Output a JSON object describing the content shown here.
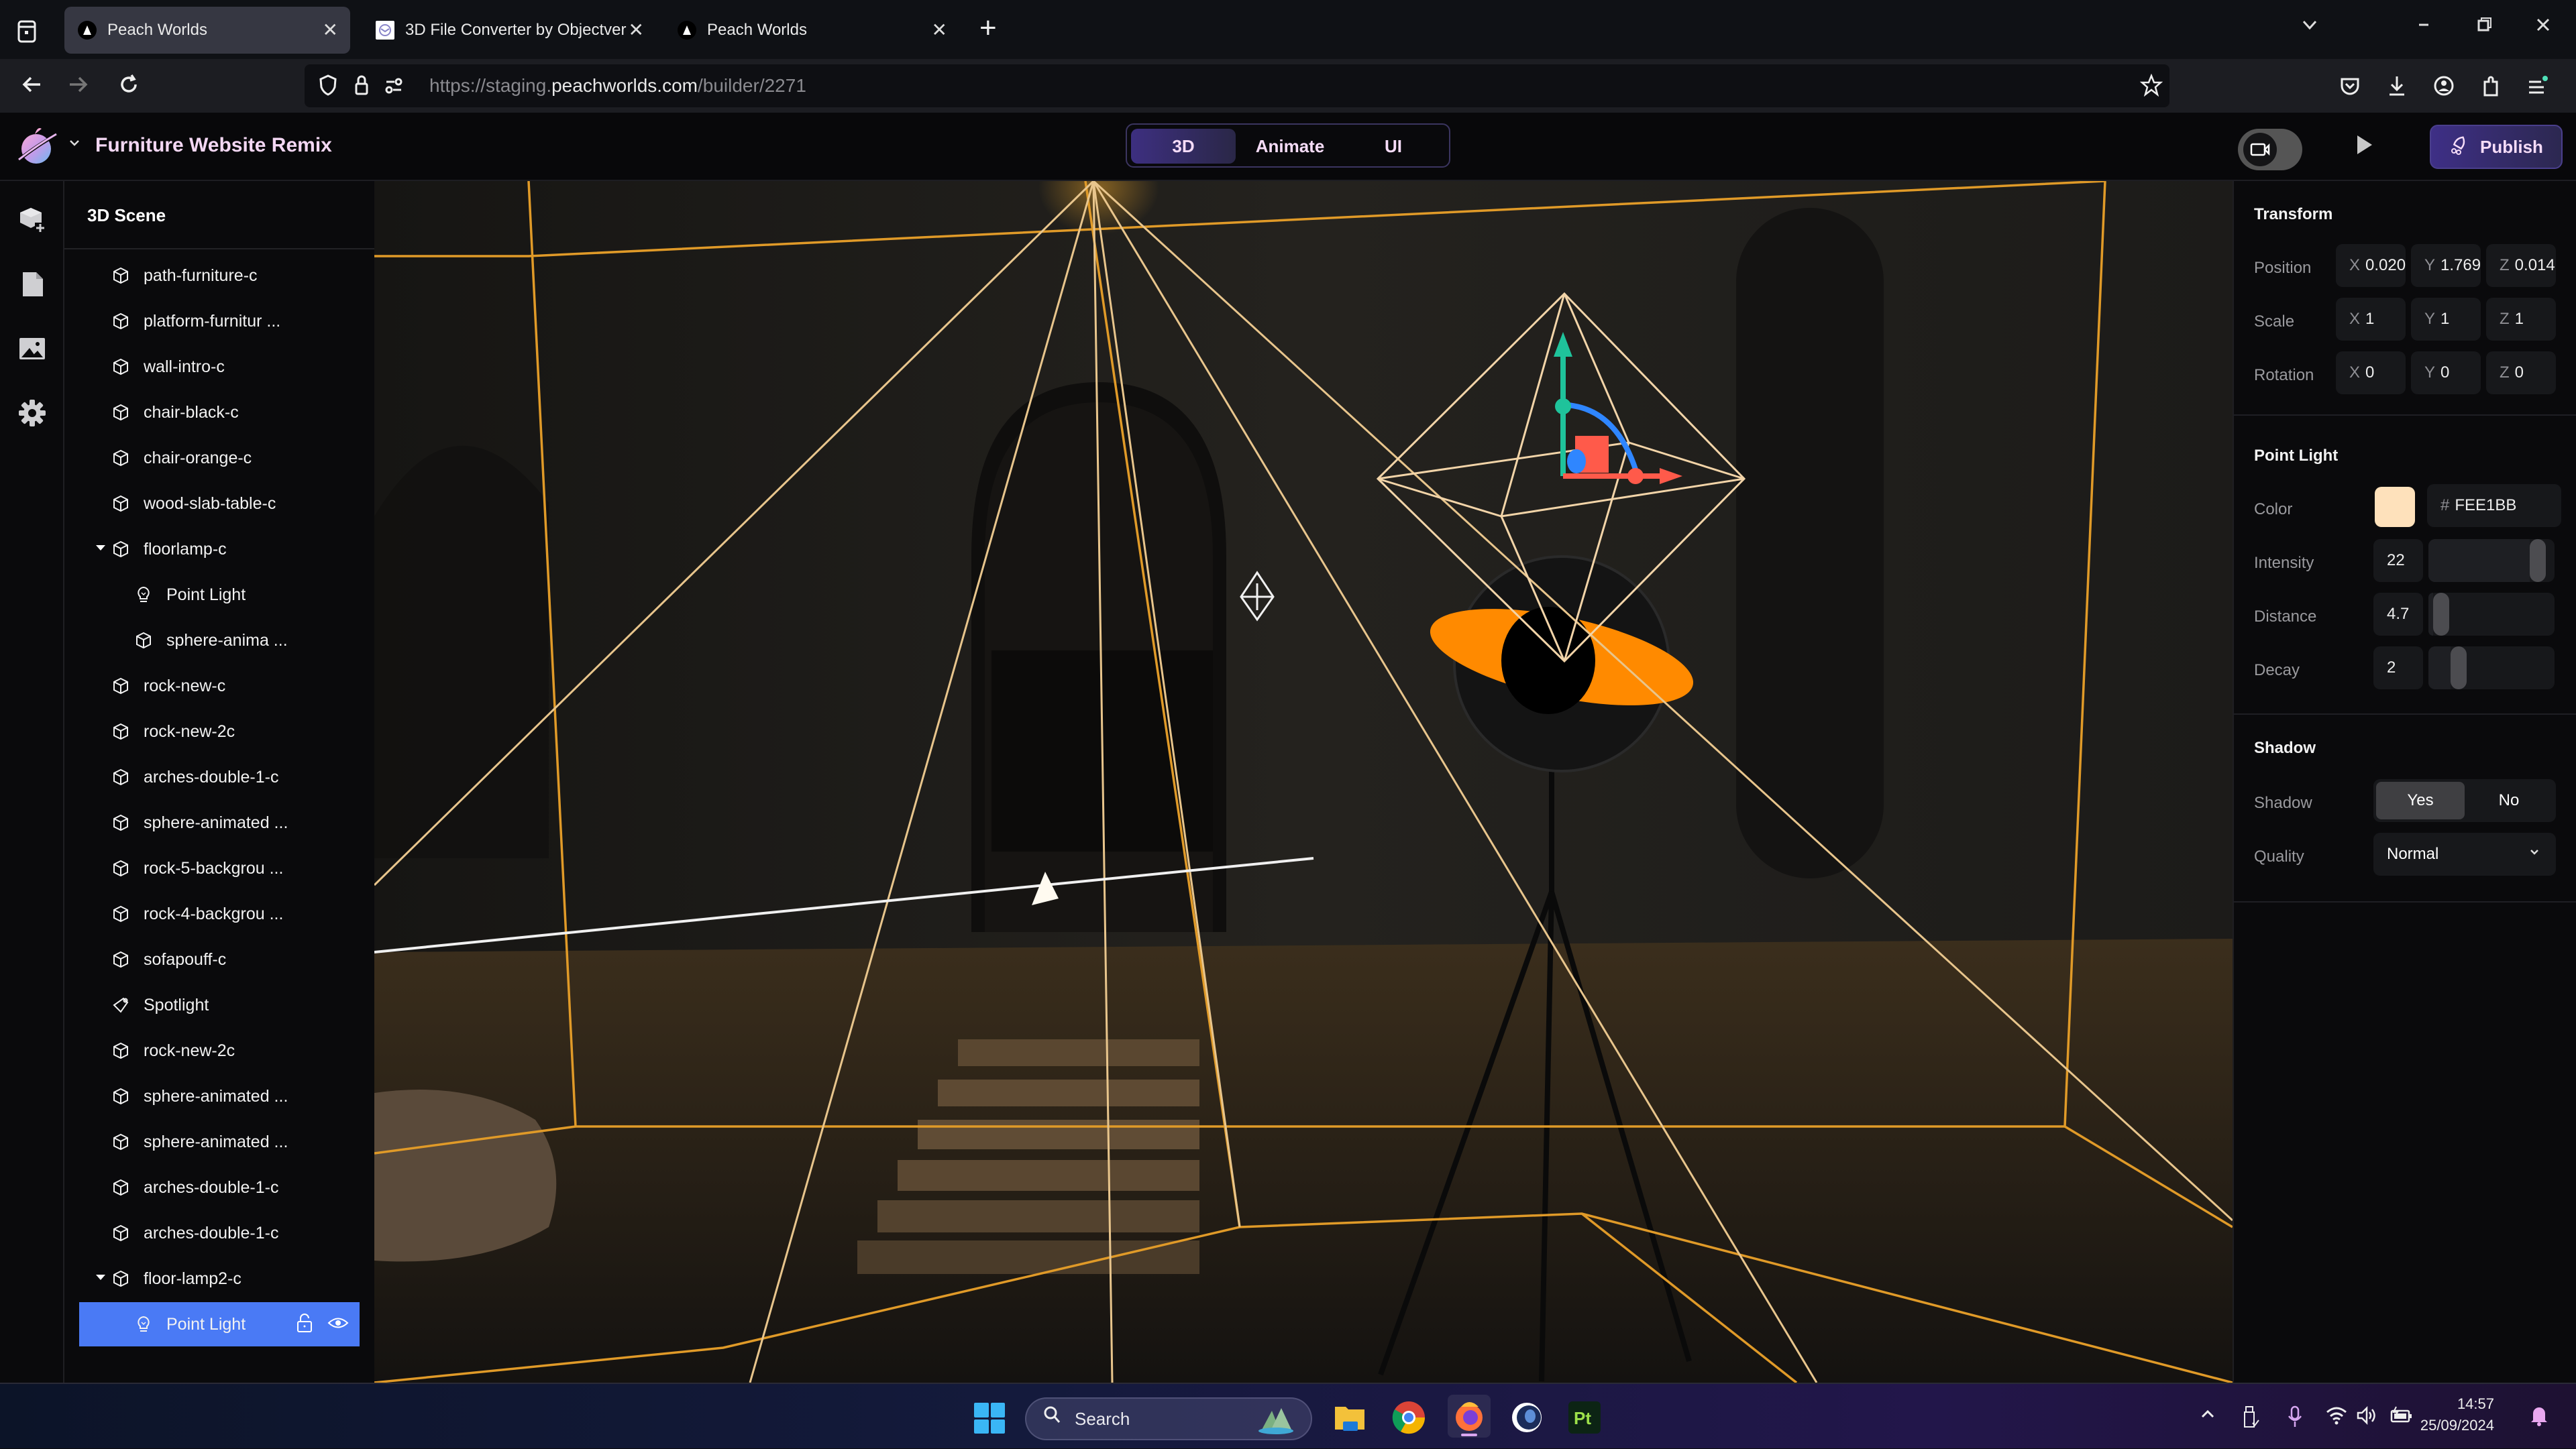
{
  "browser": {
    "tabs": [
      {
        "title": "Peach Worlds",
        "active": true
      },
      {
        "title": "3D File Converter by Objectvers",
        "active": false
      },
      {
        "title": "Peach Worlds",
        "active": false
      }
    ],
    "new_tab_label": "+",
    "url": {
      "prefix": "https://staging.",
      "host": "peachworlds.com",
      "path": "/builder/2271"
    },
    "window_controls": {
      "dropdown": "⌄",
      "minimize": "–",
      "restore": "❐",
      "close": "✕"
    }
  },
  "app": {
    "project_title": "Furniture Website Remix",
    "modes": [
      {
        "label": "3D",
        "active": true
      },
      {
        "label": "Animate",
        "active": false
      },
      {
        "label": "UI",
        "active": false
      }
    ],
    "publish_label": "Publish",
    "accent_color": "#3e2f86",
    "text_accent_color": "#f6dcf8"
  },
  "rail": {
    "items": [
      "add-object-icon",
      "file-icon",
      "image-icon",
      "settings-icon"
    ]
  },
  "scene": {
    "title": "3D Scene",
    "nodes": [
      {
        "label": "path-furniture-c",
        "type": "mesh",
        "depth": 0
      },
      {
        "label": "platform-furnitur ...",
        "type": "mesh",
        "depth": 0
      },
      {
        "label": "wall-intro-c",
        "type": "mesh",
        "depth": 0
      },
      {
        "label": "chair-black-c",
        "type": "mesh",
        "depth": 0
      },
      {
        "label": "chair-orange-c",
        "type": "mesh",
        "depth": 0
      },
      {
        "label": "wood-slab-table-c",
        "type": "mesh",
        "depth": 0
      },
      {
        "label": "floorlamp-c",
        "type": "mesh",
        "depth": 0,
        "expanded": true
      },
      {
        "label": "Point Light",
        "type": "pointlight",
        "depth": 1
      },
      {
        "label": "sphere-anima ...",
        "type": "mesh",
        "depth": 1
      },
      {
        "label": "rock-new-c",
        "type": "mesh",
        "depth": 0
      },
      {
        "label": "rock-new-2c",
        "type": "mesh",
        "depth": 0
      },
      {
        "label": "arches-double-1-c",
        "type": "mesh",
        "depth": 0
      },
      {
        "label": "sphere-animated ...",
        "type": "mesh",
        "depth": 0
      },
      {
        "label": "rock-5-backgrou ...",
        "type": "mesh",
        "depth": 0
      },
      {
        "label": "rock-4-backgrou ...",
        "type": "mesh",
        "depth": 0
      },
      {
        "label": "sofapouff-c",
        "type": "mesh",
        "depth": 0
      },
      {
        "label": "Spotlight",
        "type": "spotlight",
        "depth": 0
      },
      {
        "label": "rock-new-2c",
        "type": "mesh",
        "depth": 0
      },
      {
        "label": "sphere-animated ...",
        "type": "mesh",
        "depth": 0
      },
      {
        "label": "sphere-animated ...",
        "type": "mesh",
        "depth": 0
      },
      {
        "label": "arches-double-1-c",
        "type": "mesh",
        "depth": 0
      },
      {
        "label": "arches-double-1-c",
        "type": "mesh",
        "depth": 0
      },
      {
        "label": "floor-lamp2-c",
        "type": "mesh",
        "depth": 0,
        "expanded": true
      },
      {
        "label": "Point Light",
        "type": "pointlight",
        "depth": 1,
        "selected": true
      }
    ],
    "selection_color": "#4a7af5"
  },
  "properties": {
    "transform": {
      "title": "Transform",
      "position": {
        "label": "Position",
        "x": "0.020",
        "y": "1.769",
        "z": "0.014"
      },
      "scale": {
        "label": "Scale",
        "x": "1",
        "y": "1",
        "z": "1"
      },
      "rotation": {
        "label": "Rotation",
        "x": "0",
        "y": "0",
        "z": "0"
      }
    },
    "point_light": {
      "title": "Point Light",
      "color": {
        "label": "Color",
        "hex": "FEE1BB",
        "swatch": "#FEE1BB",
        "hash": "#"
      },
      "intensity": {
        "label": "Intensity",
        "value": "22",
        "slider_fraction": 0.92
      },
      "distance": {
        "label": "Distance",
        "value": "4.7",
        "slider_fraction": 0.04
      },
      "decay": {
        "label": "Decay",
        "value": "2",
        "slider_fraction": 0.2
      }
    },
    "shadow": {
      "title": "Shadow",
      "toggle": {
        "label": "Shadow",
        "options": [
          "Yes",
          "No"
        ],
        "selected": "Yes"
      },
      "quality": {
        "label": "Quality",
        "value": "Normal"
      }
    }
  },
  "taskbar": {
    "search_placeholder": "Search",
    "apps": [
      "file-explorer-icon",
      "chrome-icon",
      "firefox-icon",
      "cinema4d-icon",
      "substance-painter-icon"
    ],
    "time": "14:57",
    "date": "25/09/2024"
  }
}
